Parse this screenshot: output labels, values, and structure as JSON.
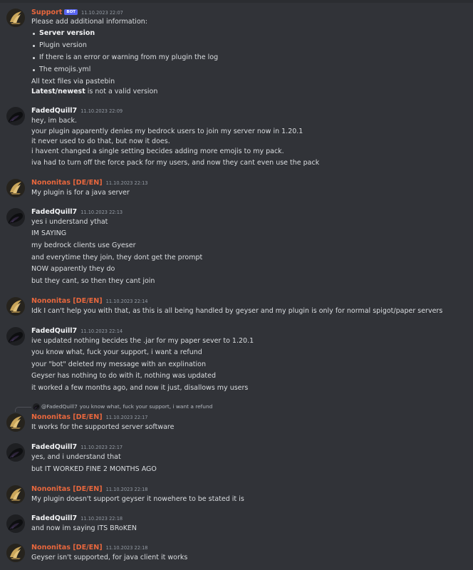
{
  "messages": [
    {
      "author": "Support",
      "bot_tag": "BOT",
      "time": "11.10.2023 22:07",
      "intro": "Please add additional information:",
      "bullets": [
        "Server version",
        "Plugin version",
        "If there is an error or warning from my plugin the log",
        "The emojis.yml"
      ],
      "outro1": "All text files via pastebin",
      "outro2_bold": "Latest/newest",
      "outro2_rest": " is not a valid version"
    },
    {
      "author": "FadedQuill7",
      "time": "11.10.2023 22:09",
      "lines": [
        "hey, im back.",
        "your plugin apparently denies my bedrock users to join my server now in 1.20.1",
        "it never used to do that, but now it does.",
        "i havent changed a single setting becides adding more emojis to my pack.",
        "iva had to turn off the force pack for my users, and now they cant even use the pack"
      ]
    },
    {
      "author": "Nononitas [DE/EN]",
      "time": "11.10.2023 22:13",
      "lines": [
        "My plugin is for a java server"
      ]
    },
    {
      "author": "FadedQuill7",
      "time": "11.10.2023 22:13",
      "lines": [
        "yes i understand ythat",
        "IM SAYING",
        "my bedrock clients use Gyeser",
        "and everytime they join, they dont get the prompt",
        "NOW apparently they do",
        "but they cant, so then they cant join"
      ]
    },
    {
      "author": "Nononitas [DE/EN]",
      "time": "11.10.2023 22:14",
      "lines": [
        "Idk I can't help you with that, as this is all being handled by geyser and my plugin is only for normal spigot/paper servers"
      ]
    },
    {
      "author": "FadedQuill7",
      "time": "11.10.2023 22:14",
      "lines": [
        "ive updated nothing becides the .jar for my paper sever to 1.20.1",
        "you know what, fuck your support, i want a refund",
        "your \"bot\" deleted my message with an explination",
        "Geyser has nothing to do with it, nothing was updated",
        "it worked a few months ago, and now it just, disallows my users"
      ]
    },
    {
      "reply_to": "@FadedQuill7",
      "reply_text": "you know what, fuck your support, i want a refund",
      "author": "Nononitas [DE/EN]",
      "time": "11.10.2023 22:17",
      "lines": [
        "It works for the supported server software"
      ]
    },
    {
      "author": "FadedQuill7",
      "time": "11.10.2023 22:17",
      "lines": [
        "yes, and i understand that",
        "but IT WORKED FINE 2 MONTHS AGO"
      ]
    },
    {
      "author": "Nononitas [DE/EN]",
      "time": "11.10.2023 22:18",
      "lines": [
        "My plugin doesn't support geyser it nowehere to be stated it is"
      ]
    },
    {
      "author": "FadedQuill7",
      "time": "11.10.2023 22:18",
      "lines": [
        "and now im saying ITS BRoKEN"
      ]
    },
    {
      "author": "Nononitas [DE/EN]",
      "time": "11.10.2023 22:18",
      "lines": [
        "Geyser isn't supported, for java client it works"
      ]
    }
  ]
}
